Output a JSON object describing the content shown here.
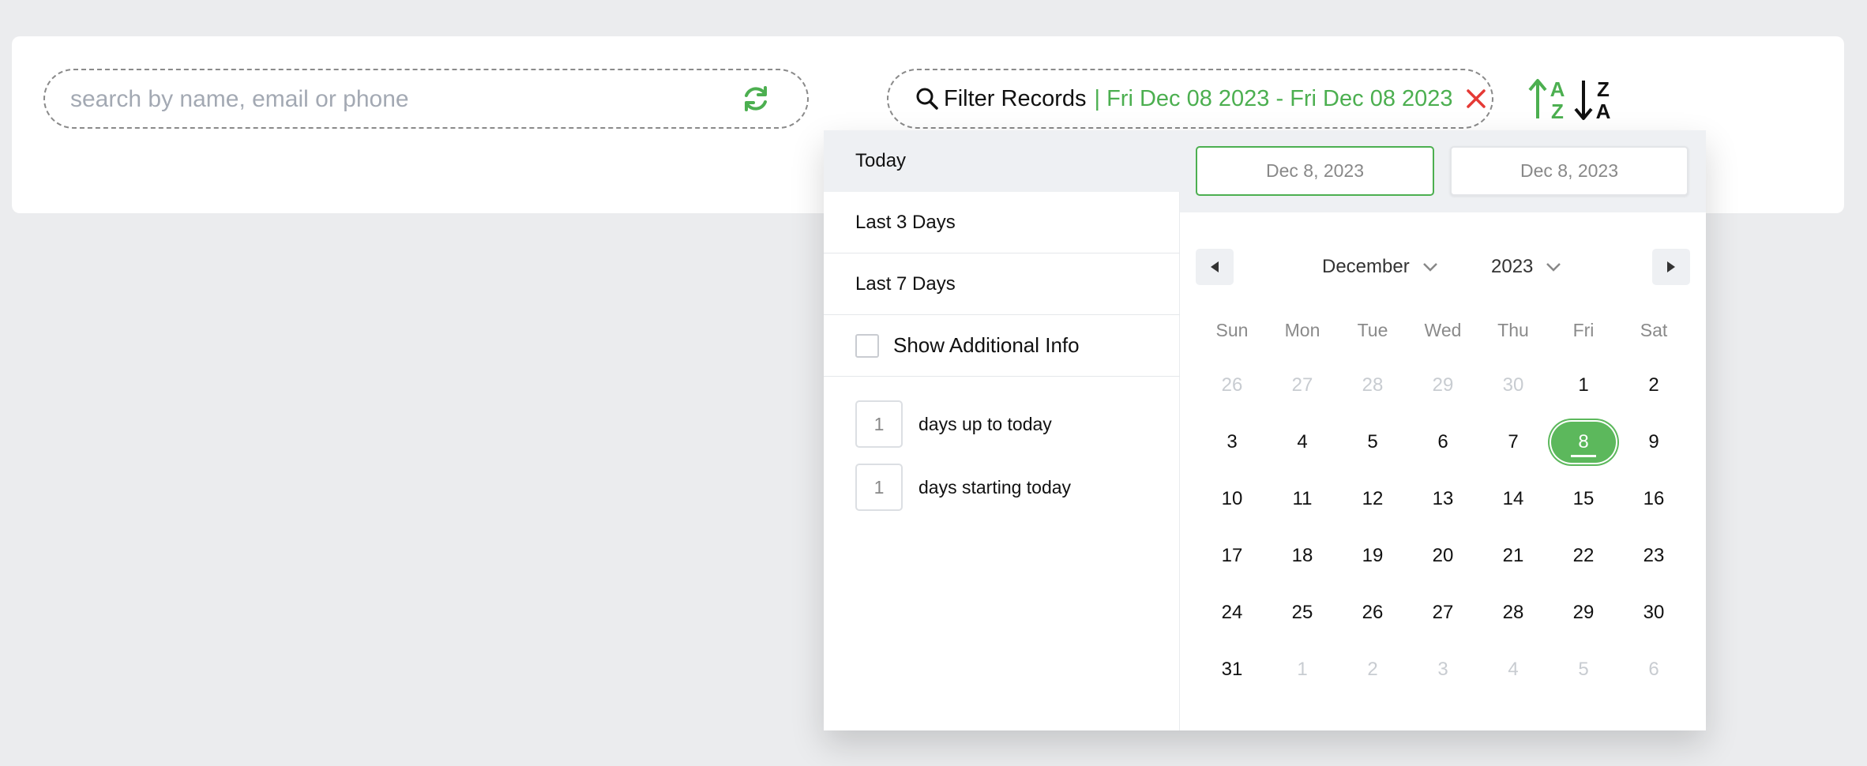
{
  "search": {
    "placeholder": "search by name, email or phone",
    "value": ""
  },
  "filter": {
    "label": "Filter Records",
    "range": "| Fri Dec 08 2023 - Fri Dec 08 2023",
    "accent": "#4caf50",
    "clear_color": "#e53935"
  },
  "sort": {
    "asc": {
      "top": "A",
      "bottom": "Z",
      "color": "#4caf50"
    },
    "desc": {
      "top": "Z",
      "bottom": "A",
      "color": "#111111"
    }
  },
  "presets": {
    "today": "Today",
    "last3": "Last 3 Days",
    "last7": "Last 7 Days",
    "show_info": "Show Additional Info",
    "days_up_value": "1",
    "days_up_label": "days up to today",
    "days_start_value": "1",
    "days_start_label": "days starting today"
  },
  "calendar": {
    "start_date": "Dec 8, 2023",
    "end_date": "Dec 8, 2023",
    "month": "December",
    "year": "2023",
    "weekdays": [
      "Sun",
      "Mon",
      "Tue",
      "Wed",
      "Thu",
      "Fri",
      "Sat"
    ],
    "weeks": [
      [
        {
          "d": "26",
          "m": true
        },
        {
          "d": "27",
          "m": true
        },
        {
          "d": "28",
          "m": true
        },
        {
          "d": "29",
          "m": true
        },
        {
          "d": "30",
          "m": true
        },
        {
          "d": "1"
        },
        {
          "d": "2"
        }
      ],
      [
        {
          "d": "3"
        },
        {
          "d": "4"
        },
        {
          "d": "5"
        },
        {
          "d": "6"
        },
        {
          "d": "7"
        },
        {
          "d": "8",
          "s": true
        },
        {
          "d": "9"
        }
      ],
      [
        {
          "d": "10"
        },
        {
          "d": "11"
        },
        {
          "d": "12"
        },
        {
          "d": "13"
        },
        {
          "d": "14"
        },
        {
          "d": "15"
        },
        {
          "d": "16"
        }
      ],
      [
        {
          "d": "17"
        },
        {
          "d": "18"
        },
        {
          "d": "19"
        },
        {
          "d": "20"
        },
        {
          "d": "21"
        },
        {
          "d": "22"
        },
        {
          "d": "23"
        }
      ],
      [
        {
          "d": "24"
        },
        {
          "d": "25"
        },
        {
          "d": "26"
        },
        {
          "d": "27"
        },
        {
          "d": "28"
        },
        {
          "d": "29"
        },
        {
          "d": "30"
        }
      ],
      [
        {
          "d": "31"
        },
        {
          "d": "1",
          "m": true
        },
        {
          "d": "2",
          "m": true
        },
        {
          "d": "3",
          "m": true
        },
        {
          "d": "4",
          "m": true
        },
        {
          "d": "5",
          "m": true
        },
        {
          "d": "6",
          "m": true
        }
      ]
    ],
    "selected_color": "#5cb85c"
  }
}
